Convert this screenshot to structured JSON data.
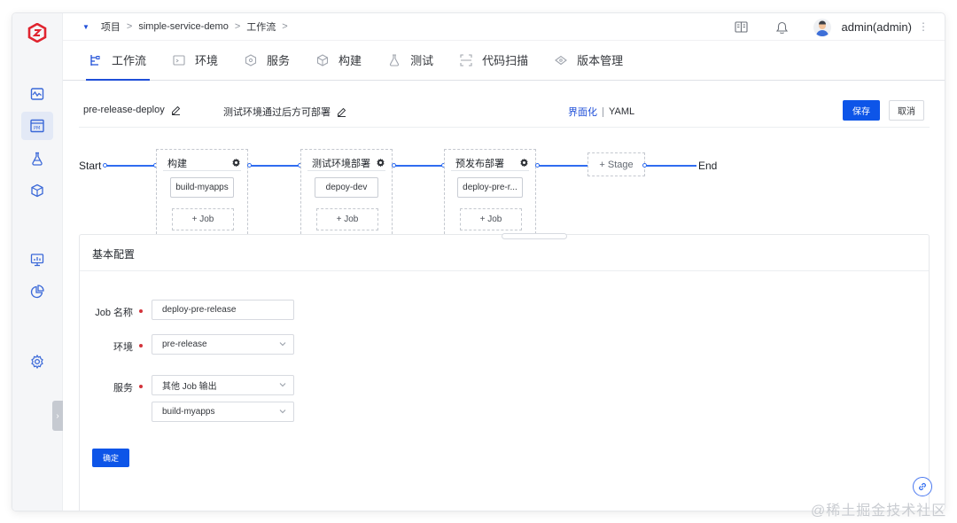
{
  "breadcrumb": {
    "items": [
      "项目",
      "simple-service-demo",
      "工作流"
    ],
    "separator": ">"
  },
  "user": {
    "name": "admin(admin)"
  },
  "tabs": [
    {
      "label": "工作流",
      "icon": "workflow-icon",
      "active": true
    },
    {
      "label": "环境",
      "icon": "environment-icon"
    },
    {
      "label": "服务",
      "icon": "service-icon"
    },
    {
      "label": "构建",
      "icon": "build-icon"
    },
    {
      "label": "测试",
      "icon": "test-icon"
    },
    {
      "label": "代码扫描",
      "icon": "scan-icon"
    },
    {
      "label": "版本管理",
      "icon": "version-icon"
    }
  ],
  "workflow": {
    "name": "pre-release-deploy",
    "description": "测试环境通过后方可部署",
    "mode_visual": "界面化",
    "mode_yaml": "YAML",
    "save_label": "保存",
    "cancel_label": "取消"
  },
  "pipeline": {
    "start_label": "Start",
    "end_label": "End",
    "add_stage_label": "+ Stage",
    "stages": [
      {
        "name": "构建",
        "job": "build-myapps",
        "add_job_label": "+ Job"
      },
      {
        "name": "测试环境部署",
        "job": "depoy-dev",
        "add_job_label": "+ Job"
      },
      {
        "name": "预发布部署",
        "job": "deploy-pre-r...",
        "add_job_label": "+ Job"
      }
    ]
  },
  "config": {
    "title": "基本配置",
    "job_name_label": "Job 名称",
    "job_name_value": "deploy-pre-release",
    "env_label": "环境",
    "env_value": "pre-release",
    "service_label": "服务",
    "service_source_value": "其他 Job 输出",
    "service_job_value": "build-myapps",
    "confirm_label": "确定"
  },
  "watermark": "@稀土掘金技术社区",
  "colors": {
    "primary": "#0d55e8",
    "accent": "#1f4fd8",
    "required": "#d3333a",
    "line": "#2f6cf0"
  }
}
